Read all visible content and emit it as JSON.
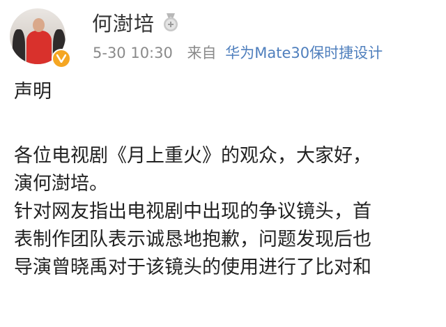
{
  "user": {
    "name": "何澍培",
    "post_time": "5-30 10:30",
    "source_prefix": "来自",
    "source_device": "华为Mate30保时捷设计"
  },
  "post": {
    "title": "声明",
    "lines": [
      "各位电视剧《月上重火》的观众，大家好，",
      "演何澍培。",
      "针对网友指出电视剧中出现的争议镜头，首",
      "表制作团队表示诚恳地抱歉，问题发现后也",
      "导演曾晓禹对于该镜头的使用进行了比对和"
    ]
  },
  "icons": {
    "avatar": "avatar",
    "verified": "verified-badge-icon",
    "medal": "medal-icon"
  },
  "colors": {
    "link": "#4f7fbd",
    "meta": "#8a8a8a",
    "verified": "#f5a623"
  }
}
